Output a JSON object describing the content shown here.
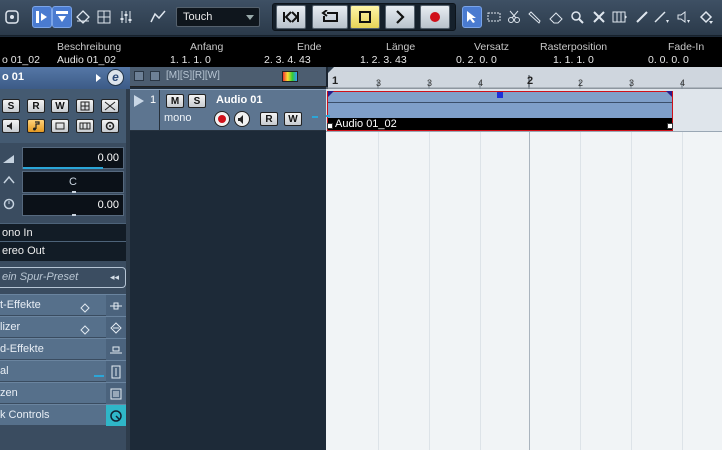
{
  "toolbar": {
    "automation_mode": "Touch",
    "accent": "#4a7bd0",
    "transport_active": "cycle"
  },
  "infoline": {
    "columns": [
      {
        "header": "Beschreibung",
        "value": "o 01_02"
      },
      {
        "header": "",
        "value": "Audio 01_02"
      },
      {
        "header": "Anfang",
        "value": "1. 1. 1.   0"
      },
      {
        "header": "Ende",
        "value": "2. 3. 4. 43"
      },
      {
        "header": "Länge",
        "value": "1. 2. 3. 43"
      },
      {
        "header": "Versatz",
        "value": "0. 2. 0.   0"
      },
      {
        "header": "Rasterposition",
        "value": "1. 1. 1.   0"
      },
      {
        "header": "Fade-In",
        "value": "0. 0. 0.   0"
      }
    ]
  },
  "inspector": {
    "track_name": "o 01",
    "buttons": {
      "s": "S",
      "r": "R",
      "w": "W"
    },
    "volume": "0.00",
    "pan": "C",
    "delay": "0.00",
    "input_routing": "ono In",
    "output_routing": "ereo Out",
    "preset_placeholder": "ein Spur-Preset",
    "sections": [
      {
        "label": "t-Effekte"
      },
      {
        "label": "lizer"
      },
      {
        "label": "d-Effekte"
      },
      {
        "label": "al"
      },
      {
        "label": "zen"
      },
      {
        "label": "k Controls"
      }
    ]
  },
  "track": {
    "number": "1",
    "name": "Audio 01",
    "channel": "mono",
    "m": "M",
    "s": "S",
    "r": "R",
    "w": "W"
  },
  "ruler": {
    "labels": [
      "1",
      "2",
      "3",
      "2",
      "2",
      "3",
      "4"
    ]
  },
  "event": {
    "name": "Audio 01_02"
  }
}
